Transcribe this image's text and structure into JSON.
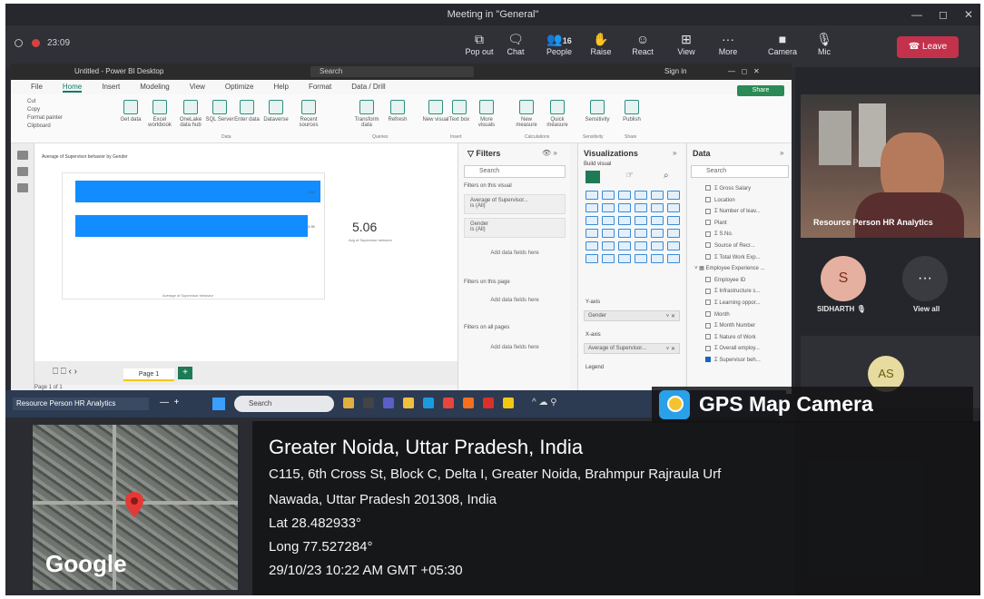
{
  "teams": {
    "window_title": "Meeting in \"General\"",
    "timer": "23:09",
    "toolbar": [
      {
        "label": "Pop out",
        "icon": "pop-out-icon"
      },
      {
        "label": "Chat",
        "icon": "chat-icon"
      },
      {
        "label": "People",
        "icon": "people-icon",
        "count": "16"
      },
      {
        "label": "Raise",
        "icon": "raise-hand-icon"
      },
      {
        "label": "React",
        "icon": "react-icon"
      },
      {
        "label": "View",
        "icon": "view-icon"
      },
      {
        "label": "More",
        "icon": "more-icon"
      },
      {
        "label": "Camera",
        "icon": "camera-icon"
      },
      {
        "label": "Mic",
        "icon": "mic-off-icon"
      }
    ],
    "leave_label": "Leave",
    "leave_color": "#c4314b"
  },
  "powerbi": {
    "title": "Untitled - Power BI Desktop",
    "search": "Search",
    "sign_in": "Sign in",
    "tabs": [
      "File",
      "Home",
      "Insert",
      "Modeling",
      "View",
      "Optimize",
      "Help",
      "Format",
      "Data / Drill"
    ],
    "ribbon": [
      {
        "label": "Paste"
      },
      {
        "label": "Get data"
      },
      {
        "label": "Excel workbook"
      },
      {
        "label": "OneLake data hub"
      },
      {
        "label": "SQL Server"
      },
      {
        "label": "Enter data"
      },
      {
        "label": "Dataverse"
      },
      {
        "label": "Recent sources"
      },
      {
        "label": "Transform data"
      },
      {
        "label": "Refresh"
      },
      {
        "label": "New visual"
      },
      {
        "label": "Text box"
      },
      {
        "label": "More visuals"
      },
      {
        "label": "New measure"
      },
      {
        "label": "Quick measure"
      },
      {
        "label": "Sensitivity"
      },
      {
        "label": "Publish"
      }
    ],
    "clipboard": {
      "cut": "Cut",
      "copy": "Copy",
      "format_painter": "Format painter",
      "group": "Clipboard"
    },
    "groups": [
      "Data",
      "Queries",
      "Insert",
      "Calculations",
      "Sensitivity",
      "Share"
    ],
    "share_label": "Share",
    "chart_title": "Average of Supervisor behavior by Gender",
    "bars": [
      {
        "label": "4.15"
      },
      {
        "label": "3.95"
      }
    ],
    "x_axis_label": "Average of Supervisor behavior",
    "card_value": "5.06",
    "card_label": "Avg of Supervisor behavior",
    "page_tab": "Page 1",
    "page_status": "Page 1 of 1",
    "filters": {
      "title": "Filters",
      "search": "Search",
      "on_visual": "Filters on this visual",
      "card1_title": "Average of Supervisor...",
      "card1_sub": "is (All)",
      "card2_title": "Gender",
      "card2_sub": "is (All)",
      "add_fields": "Add data fields here",
      "on_page": "Filters on this page",
      "on_all": "Filters on all pages"
    },
    "visualizations": {
      "title": "Visualizations",
      "build": "Build visual",
      "y_axis": "Y-axis",
      "y_field": "Gender",
      "x_axis": "X-axis",
      "x_field": "Average of Supervisor...",
      "legend": "Legend"
    },
    "data": {
      "title": "Data",
      "search": "Search",
      "fields": [
        {
          "name": "Gross Salary",
          "checked": false
        },
        {
          "name": "Location",
          "checked": false
        },
        {
          "name": "Number of leav...",
          "checked": false
        },
        {
          "name": "Plant",
          "checked": false
        },
        {
          "name": "S.No.",
          "checked": false
        },
        {
          "name": "Source of Recr...",
          "checked": false
        },
        {
          "name": "Total Work Exp...",
          "checked": false
        },
        {
          "name": "Employee Experience ...",
          "checked": false
        },
        {
          "name": "Employee ID",
          "checked": false
        },
        {
          "name": "Infrastructure s...",
          "checked": false
        },
        {
          "name": "Learning oppor...",
          "checked": false
        },
        {
          "name": "Month",
          "checked": false
        },
        {
          "name": "Month Number",
          "checked": false
        },
        {
          "name": "Nature of Work",
          "checked": false
        },
        {
          "name": "Overall employ...",
          "checked": false
        },
        {
          "name": "Supervisor beh...",
          "checked": true
        }
      ]
    }
  },
  "participants": {
    "video_name": "Resource Person HR Analytics",
    "p1_initial": "S",
    "p1_name": "SIDHARTH",
    "view_all": "View all",
    "p2_initial": "AS"
  },
  "taskbar": {
    "app": "Resource Person HR Analytics",
    "search": "Search"
  },
  "gps": {
    "badge": "GPS Map Camera",
    "title": "Greater Noida, Uttar Pradesh, India",
    "address1": "C115, 6th Cross St, Block C, Delta I, Greater Noida, Brahmpur Rajraula Urf",
    "address2": "Nawada, Uttar Pradesh 201308, India",
    "lat": "Lat 28.482933°",
    "long": "Long 77.527284°",
    "datetime": "29/10/23 10:22 AM GMT +05:30",
    "map_brand": "Google"
  }
}
